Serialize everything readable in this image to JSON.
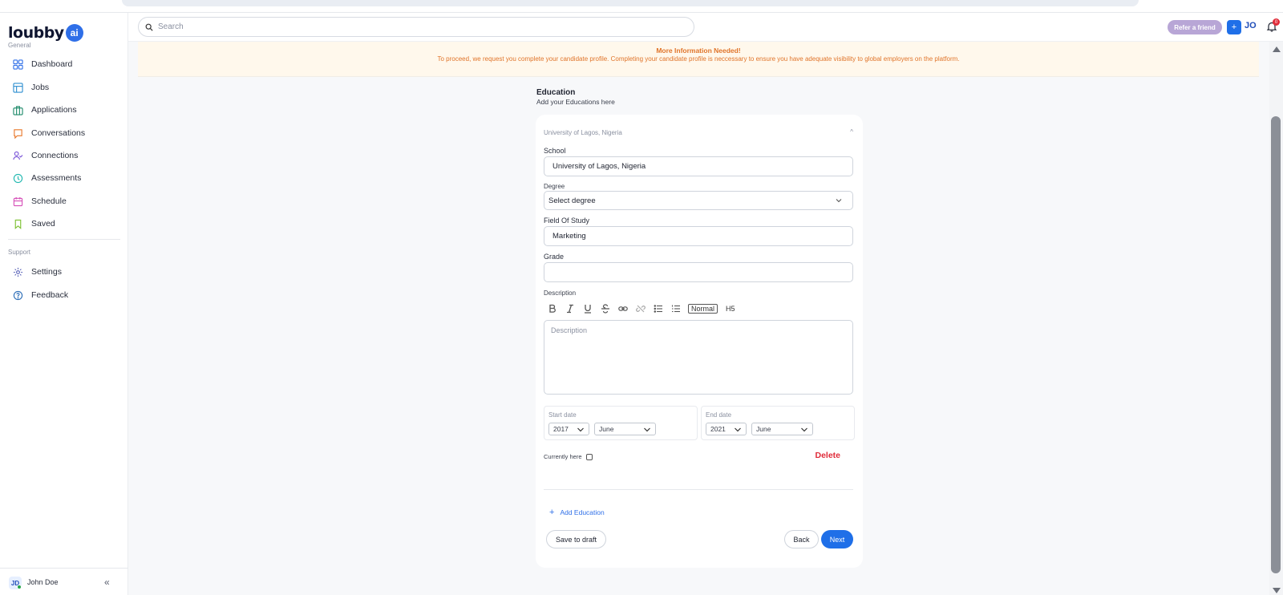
{
  "app": {
    "logo_text": "loubby",
    "logo_badge": "ai"
  },
  "sidebar": {
    "general_label": "General",
    "items": [
      {
        "label": "Dashboard",
        "icon": "grid-icon"
      },
      {
        "label": "Jobs",
        "icon": "layout-icon"
      },
      {
        "label": "Applications",
        "icon": "briefcase-icon"
      },
      {
        "label": "Conversations",
        "icon": "chat-bubble-icon"
      },
      {
        "label": "Connections",
        "icon": "user-check-icon"
      },
      {
        "label": "Assessments",
        "icon": "clock-icon"
      },
      {
        "label": "Schedule",
        "icon": "calendar-icon"
      },
      {
        "label": "Saved",
        "icon": "bookmark-icon"
      }
    ],
    "support_label": "Support",
    "support_items": [
      {
        "label": "Settings",
        "icon": "gear-icon"
      },
      {
        "label": "Feedback",
        "icon": "help-circle-icon"
      }
    ],
    "user": {
      "initials": "JD",
      "name": "John Doe"
    },
    "collapse_glyph": "«"
  },
  "topbar": {
    "search_placeholder": "Search",
    "refer_label": "Refer a friend",
    "plus_label": "+",
    "user_initials": "JO",
    "notification_count": "0"
  },
  "banner": {
    "title": "More Information Needed!",
    "text": "To proceed, we request you complete your candidate profile. Completing your candidate profile is neccessary to ensure you have adequate visibility to global employers on the platform."
  },
  "education": {
    "title": "Education",
    "subtitle": "Add your Educations here",
    "entry_header": "University of Lagos, Nigeria",
    "school_label": "School",
    "school_value": "University of Lagos, Nigeria",
    "degree_label": "Degree",
    "degree_value": "Select degree",
    "field_label": "Field Of Study",
    "field_value": "Marketing",
    "grade_label": "Grade",
    "grade_value": "",
    "description_label": "Description",
    "description_placeholder": "Description",
    "toolbar": {
      "normal_label": "Normal",
      "h5_label": "H5"
    },
    "start_date": {
      "label": "Start date",
      "year": "2017",
      "month": "June"
    },
    "end_date": {
      "label": "End date",
      "year": "2021",
      "month": "June"
    },
    "currently_here_label": "Currently here",
    "delete_label": "Delete",
    "add_education_label": "Add Education"
  },
  "actions": {
    "save_draft": "Save to draft",
    "back": "Back",
    "next": "Next"
  },
  "colors": {
    "accent": "#1f6fe8",
    "danger": "#e02c3a",
    "banner_text": "#e0742a",
    "banner_bg": "#fff8ec"
  }
}
